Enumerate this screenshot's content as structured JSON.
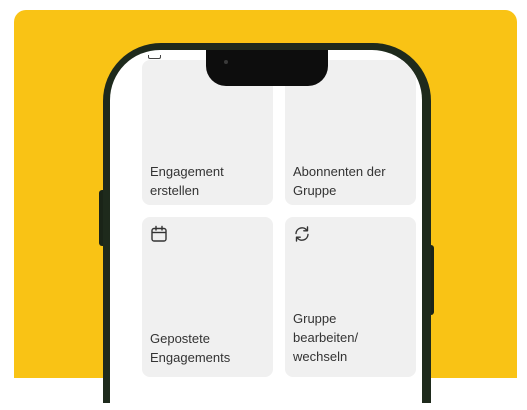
{
  "tiles": [
    {
      "label": "Engagement\nerstellen",
      "icon": null
    },
    {
      "label": "Abonnenten der\nGruppe",
      "icon": null
    },
    {
      "label": "Gepostete\nEngagements",
      "icon": "calendar-icon"
    },
    {
      "label": "Gruppe\nbearbeiten/\nwechseln",
      "icon": "refresh-icon"
    }
  ],
  "colors": {
    "background": "#f9c315",
    "phone_frame": "#1e2a1c",
    "tile": "#f0f0f0",
    "text": "#333333"
  }
}
